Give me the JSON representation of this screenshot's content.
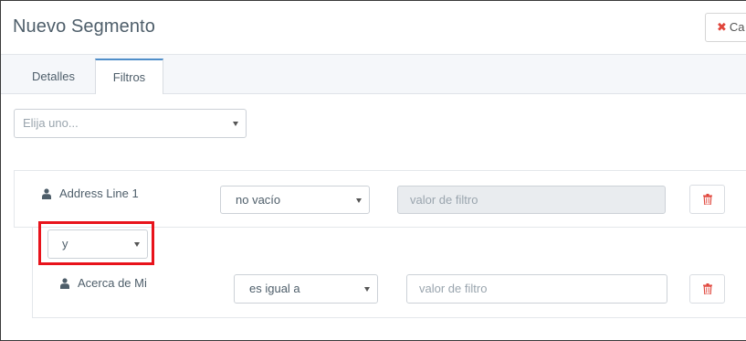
{
  "header": {
    "title": "Nuevo Segmento",
    "cancel_label": "Ca",
    "cancel_icon": "times-icon"
  },
  "tabs": [
    {
      "label": "Detalles",
      "active": false
    },
    {
      "label": "Filtros",
      "active": true
    }
  ],
  "filter_picker": {
    "placeholder": "Elija uno..."
  },
  "filters": [
    {
      "field": "Address Line 1",
      "field_icon": "user-icon",
      "operator": "no vacío",
      "value_placeholder": "valor de filtro",
      "value_disabled": true,
      "delete_icon": "trash-icon"
    },
    {
      "glue": "y",
      "field": "Acerca de Mi",
      "field_icon": "user-icon",
      "operator": "es igual a",
      "value_placeholder": "valor de filtro",
      "value_disabled": false,
      "delete_icon": "trash-icon"
    }
  ],
  "colors": {
    "accent_tab": "#4f8ec9",
    "danger": "#e0453b",
    "highlight": "#e8131b"
  }
}
